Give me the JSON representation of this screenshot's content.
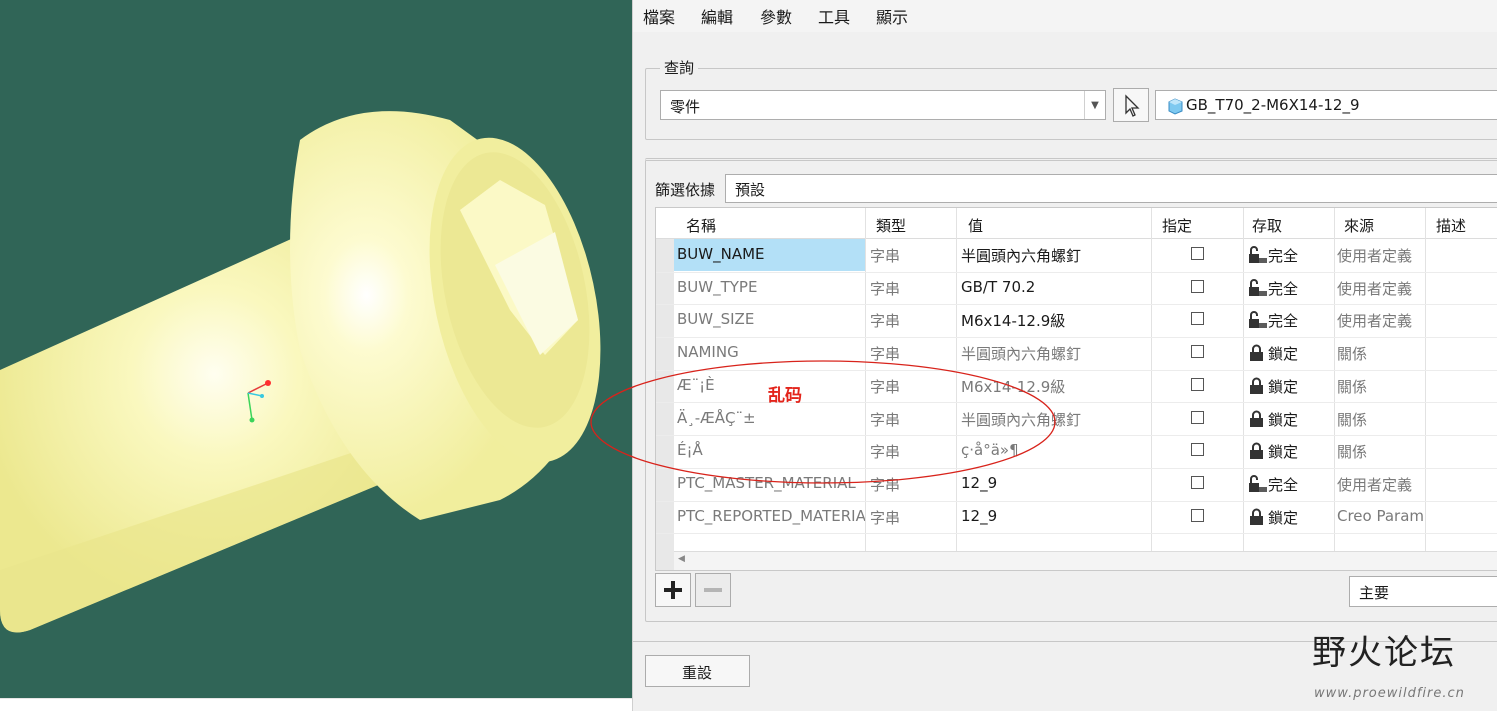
{
  "menu": [
    "檔案",
    "編輯",
    "參數",
    "工具",
    "顯示"
  ],
  "lookin": {
    "title": "查詢",
    "type_value": "零件",
    "model_name": "GB_T70_2-M6X14-12_9"
  },
  "filter": {
    "label": "篩選依據",
    "value": "預設"
  },
  "table": {
    "headers": [
      "名稱",
      "類型",
      "值",
      "指定",
      "存取",
      "來源",
      "描述"
    ],
    "rows": [
      {
        "name": "BUW_NAME",
        "type": "字串",
        "value": "半圓頭內六角螺釘",
        "access": "完全",
        "access_icon": "lock-open-icon",
        "source": "使用者定義",
        "selected": true,
        "value_gray": false
      },
      {
        "name": "BUW_TYPE",
        "type": "字串",
        "value": "GB/T 70.2",
        "access": "完全",
        "access_icon": "lock-open-icon",
        "source": "使用者定義",
        "selected": false,
        "value_gray": false
      },
      {
        "name": "BUW_SIZE",
        "type": "字串",
        "value": "M6x14-12.9級",
        "access": "完全",
        "access_icon": "lock-open-icon",
        "source": "使用者定義",
        "selected": false,
        "value_gray": false
      },
      {
        "name": "NAMING",
        "type": "字串",
        "value": "半圓頭內六角螺釘",
        "access": "鎖定",
        "access_icon": "lock-closed-icon",
        "source": "關係",
        "selected": false,
        "value_gray": true
      },
      {
        "name": "Æ¨¡È",
        "type": "字串",
        "value": "M6x14-12.9級",
        "access": "鎖定",
        "access_icon": "lock-closed-icon",
        "source": "關係",
        "selected": false,
        "value_gray": true
      },
      {
        "name": "Ä¸-ÆÅÇ¨±",
        "type": "字串",
        "value": "半圓頭內六角螺釘",
        "access": "鎖定",
        "access_icon": "lock-closed-icon",
        "source": "關係",
        "selected": false,
        "value_gray": true
      },
      {
        "name": "É¡Å",
        "type": "字串",
        "value": "ç·å°ä»¶",
        "access": "鎖定",
        "access_icon": "lock-closed-icon",
        "source": "關係",
        "selected": false,
        "value_gray": true
      },
      {
        "name": "PTC_MASTER_MATERIAL",
        "type": "字串",
        "value": "12_9",
        "access": "完全",
        "access_icon": "lock-open-icon",
        "source": "使用者定義",
        "selected": false,
        "value_gray": false
      },
      {
        "name": "PTC_REPORTED_MATERIAL",
        "type": "字串",
        "value": "12_9",
        "access": "鎖定",
        "access_icon": "lock-closed-icon",
        "source": "Creo Parametric",
        "selected": false,
        "value_gray": false
      }
    ]
  },
  "bottom": {
    "add_icon": "plus-icon",
    "remove_icon": "minus-icon",
    "view_select": "主要",
    "reset_label": "重設"
  },
  "annotation": {
    "text": "乱码",
    "color": "#e3241b"
  },
  "watermark": {
    "title": "野火论坛",
    "url": "www.proewildfire.cn"
  },
  "colors": {
    "viewport_bg": "#306557",
    "part_color": "#f6f3a8",
    "selection": "#b3e0f7"
  }
}
